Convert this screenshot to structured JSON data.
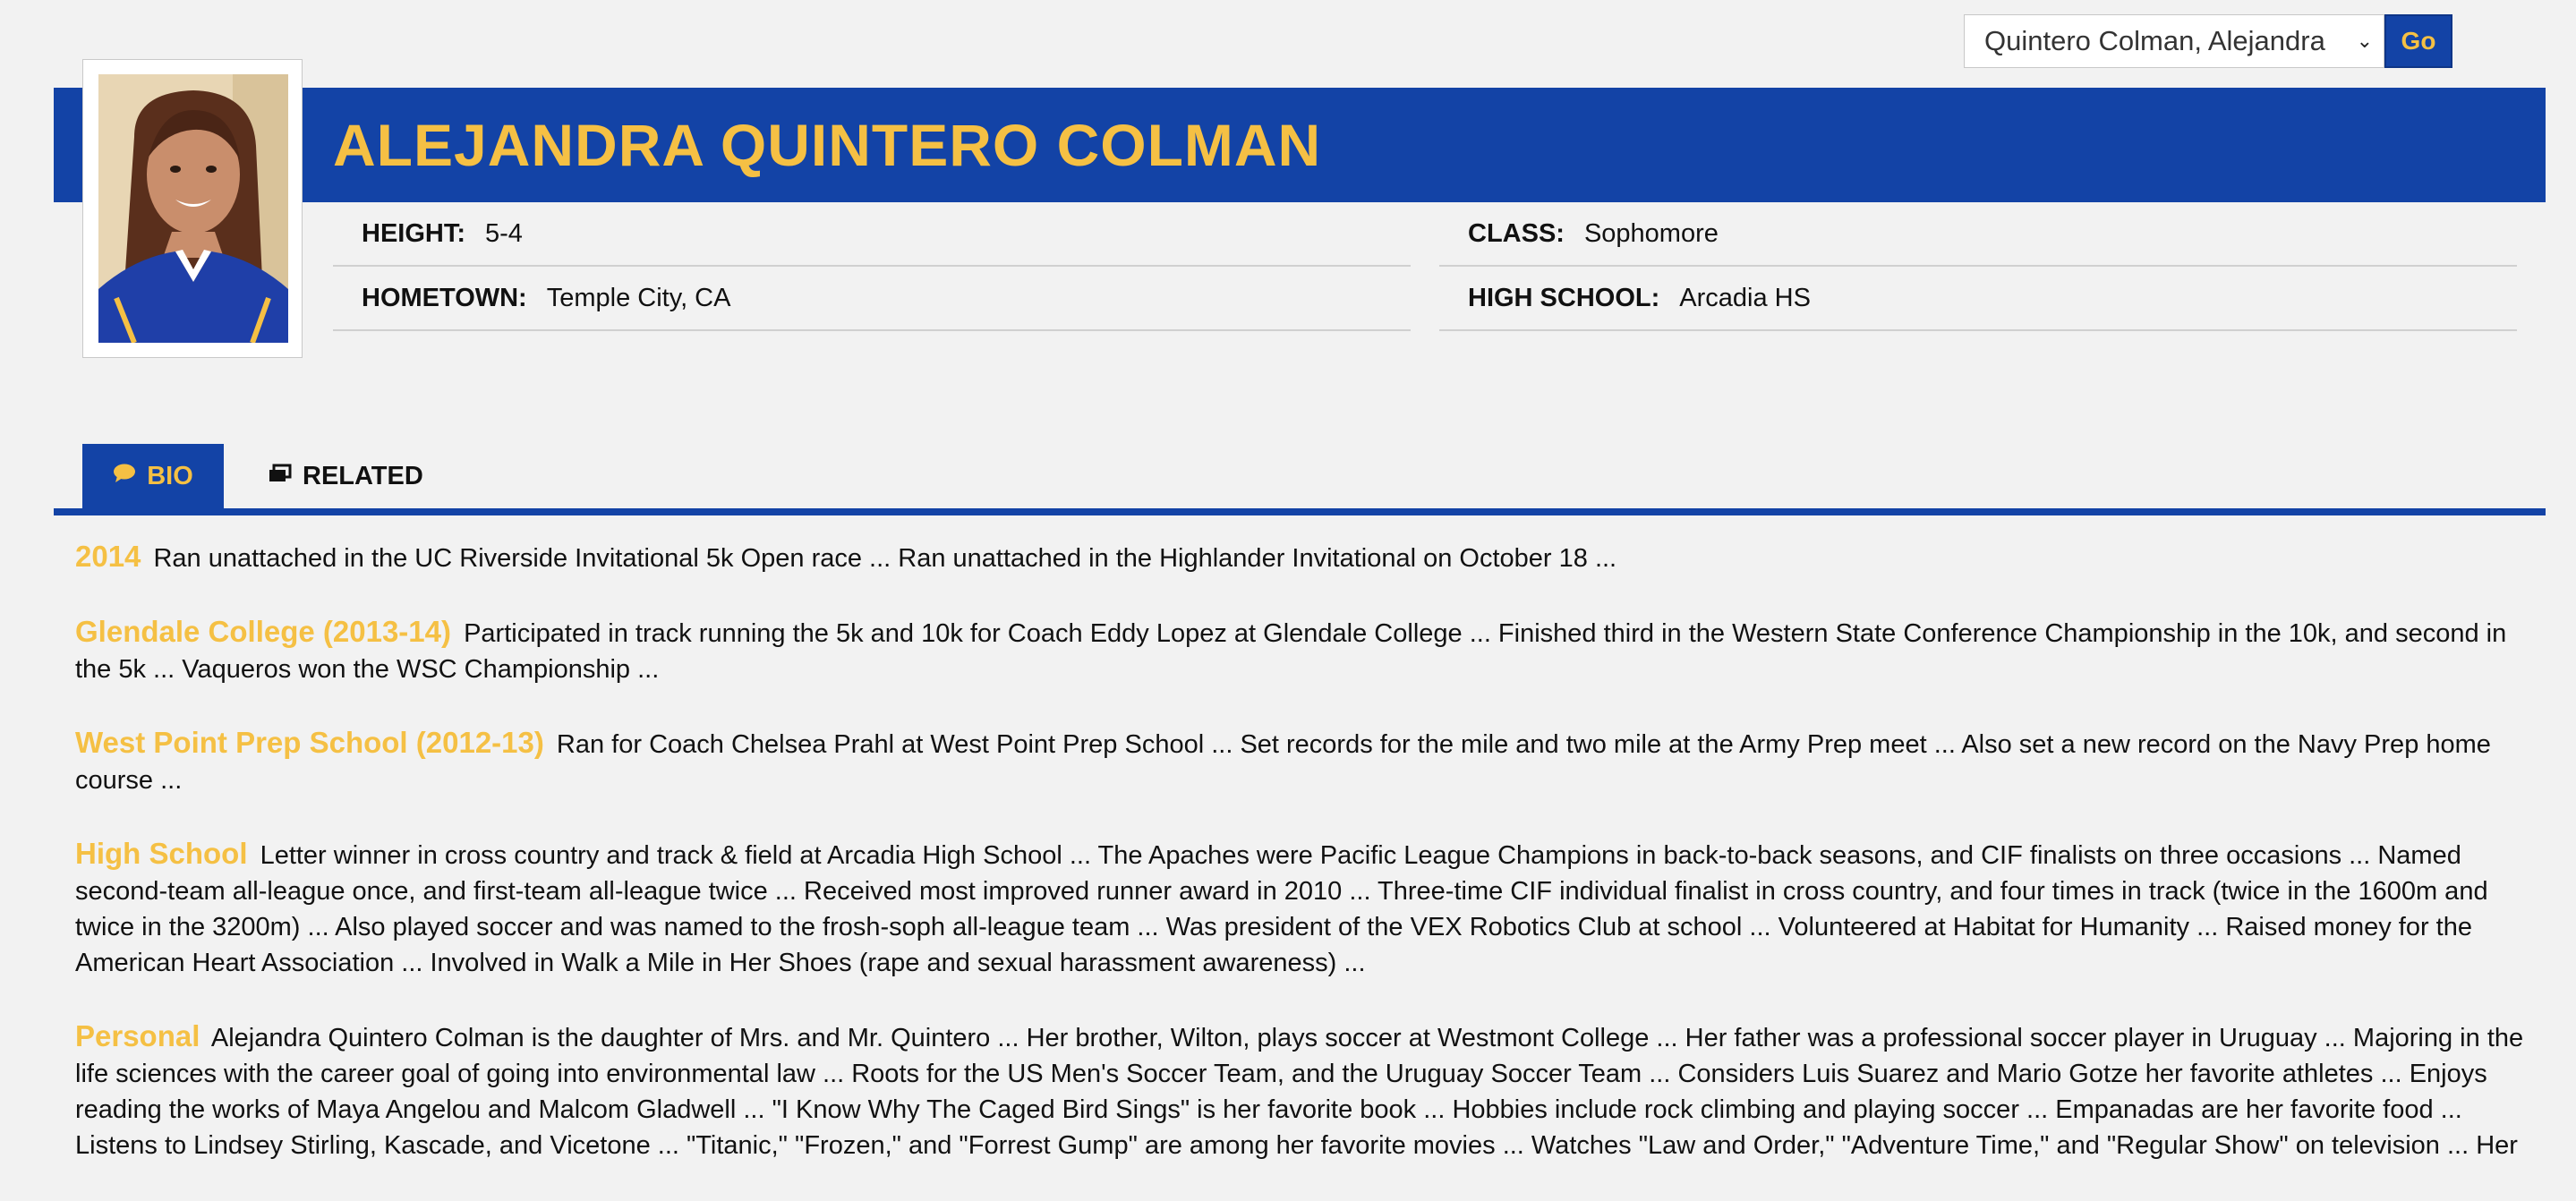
{
  "roster_select": {
    "selected": "Quintero Colman, Alejandra",
    "go_label": "Go"
  },
  "player": {
    "name": "ALEJANDRA QUINTERO COLMAN"
  },
  "details": {
    "height_label": "HEIGHT:",
    "height_value": "5-4",
    "class_label": "CLASS:",
    "class_value": "Sophomore",
    "hometown_label": "HOMETOWN:",
    "hometown_value": "Temple City, CA",
    "highschool_label": "HIGH SCHOOL:",
    "highschool_value": "Arcadia HS"
  },
  "tabs": [
    {
      "label": "BIO",
      "icon": "speech-bubble-icon"
    },
    {
      "label": "RELATED",
      "icon": "photos-icon"
    }
  ],
  "bio": [
    {
      "heading": "2014",
      "text": "Ran unattached in the UC Riverside Invitational 5k Open race ... Ran unattached in the Highlander Invitational on October 18 ..."
    },
    {
      "heading": "Glendale College (2013-14)",
      "text": "Participated in track running the 5k and 10k for Coach Eddy Lopez at Glendale College ... Finished third in the Western State Conference Championship in the 10k, and second in the 5k ... Vaqueros won the WSC Championship ..."
    },
    {
      "heading": "West Point Prep School (2012-13)",
      "text": "Ran for Coach Chelsea Prahl at West Point Prep School ... Set records for the mile and two mile at the Army Prep meet ... Also set a new record on the Navy Prep home course ..."
    },
    {
      "heading": "High School",
      "text": "Letter winner in cross country and track & field at Arcadia High School ... The Apaches were Pacific League Champions in back-to-back seasons, and CIF finalists on three occasions ... Named second-team all-league once, and first-team all-league twice ... Received most improved runner award in 2010 ... Three-time CIF individual finalist in cross country, and four times in track (twice in the 1600m and twice in the 3200m) ... Also played soccer and was named to the frosh-soph all-league team ... Was president of the VEX Robotics Club at school ... Volunteered at Habitat for Humanity ... Raised money for the American Heart Association ... Involved in Walk a Mile in Her Shoes (rape and sexual harassment awareness) ..."
    },
    {
      "heading": "Personal",
      "text": "Alejandra Quintero Colman is the daughter of Mrs. and Mr. Quintero ... Her brother, Wilton, plays soccer at Westmont College ... Her father was a professional soccer player in Uruguay ... Majoring in the life sciences with the career goal of going into environmental law ... Roots for the US Men's Soccer Team, and the Uruguay Soccer Team ... Considers Luis Suarez and Mario Gotze her favorite athletes ... Enjoys reading the works of Maya Angelou and Malcom Gladwell ... \"I Know Why The Caged Bird Sings\" is her favorite book ... Hobbies include rock climbing and playing soccer ... Empanadas are her favorite food ... Listens to Lindsey Stirling, Kascade, and Vicetone ... \"Titanic,\" \"Frozen,\" and \"Forrest Gump\" are among her favorite movies ... Watches \"Law and Order,\" \"Adventure Time,\" and \"Regular Show\" on television ... Her"
    }
  ],
  "colors": {
    "brand_blue": "#1343a6",
    "brand_gold": "#f5c044"
  }
}
